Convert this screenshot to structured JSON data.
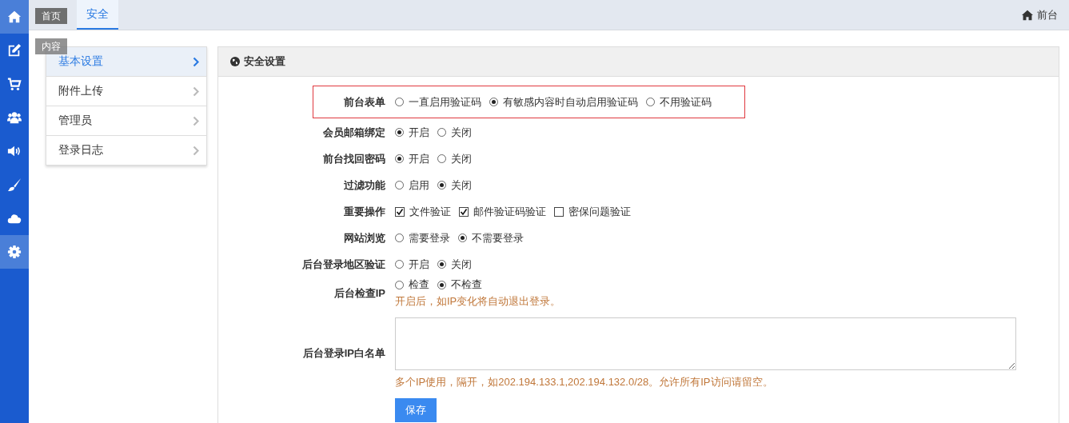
{
  "sidebar": {
    "items": [
      {
        "tooltip": "首页",
        "highlighted": true
      },
      {
        "tooltip": "内容",
        "highlighted": false
      },
      {
        "highlighted": false
      },
      {
        "highlighted": false
      },
      {
        "highlighted": false
      },
      {
        "highlighted": false
      },
      {
        "highlighted": false
      },
      {
        "highlighted": true
      }
    ]
  },
  "tabs": [
    {
      "label": "安全",
      "selected": true
    }
  ],
  "top_link": {
    "label": "前台"
  },
  "submenu": {
    "items": [
      {
        "label": "基本设置",
        "selected": true
      },
      {
        "label": "附件上传",
        "selected": false
      },
      {
        "label": "管理员",
        "selected": false
      },
      {
        "label": "登录日志",
        "selected": false
      }
    ]
  },
  "panel": {
    "title": "安全设置"
  },
  "form": {
    "rows": [
      {
        "kind": "radio",
        "label": "前台表单",
        "highlighted": true,
        "options": [
          {
            "label": "一直启用验证码",
            "selected": false
          },
          {
            "label": "有敏感内容时自动启用验证码",
            "selected": true
          },
          {
            "label": "不用验证码",
            "selected": false
          }
        ]
      },
      {
        "kind": "radio",
        "label": "会员邮箱绑定",
        "highlighted": false,
        "options": [
          {
            "label": "开启",
            "selected": true
          },
          {
            "label": "关闭",
            "selected": false
          }
        ]
      },
      {
        "kind": "radio",
        "label": "前台找回密码",
        "highlighted": false,
        "options": [
          {
            "label": "开启",
            "selected": true
          },
          {
            "label": "关闭",
            "selected": false
          }
        ]
      },
      {
        "kind": "radio",
        "label": "过滤功能",
        "highlighted": false,
        "options": [
          {
            "label": "启用",
            "selected": false
          },
          {
            "label": "关闭",
            "selected": true
          }
        ]
      },
      {
        "kind": "checkbox",
        "label": "重要操作",
        "highlighted": false,
        "options": [
          {
            "label": "文件验证",
            "checked": true
          },
          {
            "label": "邮件验证码验证",
            "checked": true
          },
          {
            "label": "密保问题验证",
            "checked": false
          }
        ]
      },
      {
        "kind": "radio",
        "label": "网站浏览",
        "highlighted": false,
        "options": [
          {
            "label": "需要登录",
            "selected": false
          },
          {
            "label": "不需要登录",
            "selected": true
          }
        ]
      },
      {
        "kind": "radio",
        "label": "后台登录地区验证",
        "highlighted": false,
        "options": [
          {
            "label": "开启",
            "selected": false
          },
          {
            "label": "关闭",
            "selected": true
          }
        ]
      },
      {
        "kind": "radio",
        "label": "后台检查IP",
        "highlighted": false,
        "hint": "开启后，如IP变化将自动退出登录。",
        "options": [
          {
            "label": "检查",
            "selected": false
          },
          {
            "label": "不检查",
            "selected": true
          }
        ]
      },
      {
        "kind": "textarea",
        "label": "后台登录IP白名单",
        "highlighted": false,
        "hint": "多个IP使用，隔开，如202.194.133.1,202.194.132.0/28。允许所有IP访问请留空。"
      }
    ]
  },
  "save_button": {
    "label": "保存"
  }
}
